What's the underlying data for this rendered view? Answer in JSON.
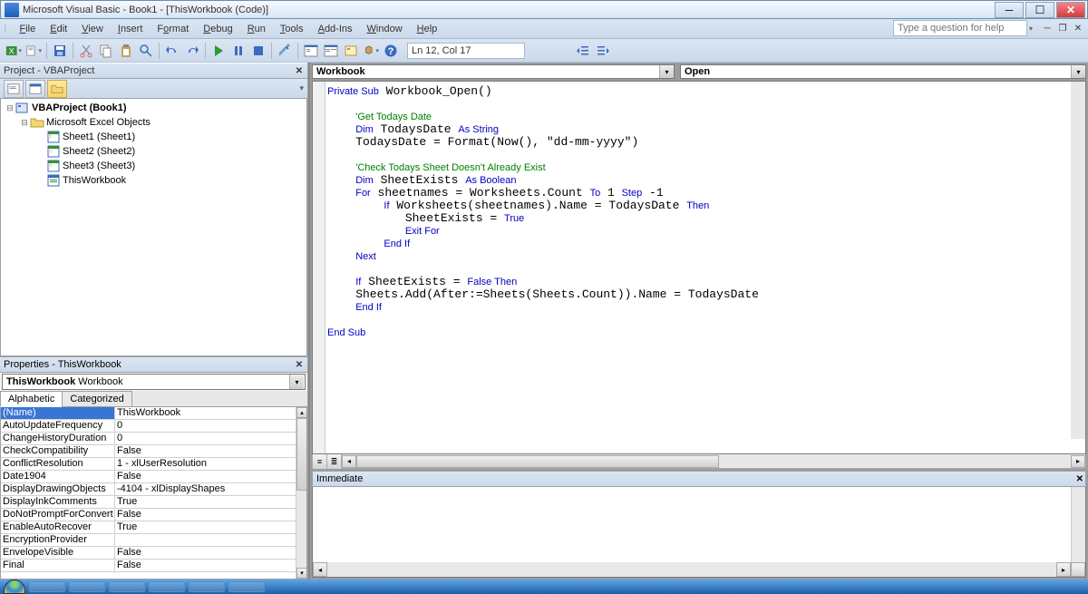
{
  "titlebar": {
    "text": "Microsoft Visual Basic - Book1 - [ThisWorkbook (Code)]"
  },
  "menubar": {
    "items": [
      {
        "pre": "F",
        "mid": "",
        "post": "ile"
      },
      {
        "pre": "E",
        "mid": "",
        "post": "dit"
      },
      {
        "pre": "V",
        "mid": "",
        "post": "iew"
      },
      {
        "pre": "I",
        "mid": "",
        "post": "nsert"
      },
      {
        "pre": "F",
        "mid": "o",
        "post": "rmat"
      },
      {
        "pre": "D",
        "mid": "",
        "post": "ebug"
      },
      {
        "pre": "R",
        "mid": "",
        "post": "un"
      },
      {
        "pre": "T",
        "mid": "",
        "post": "ools"
      },
      {
        "pre": "A",
        "mid": "",
        "post": "dd-Ins"
      },
      {
        "pre": "W",
        "mid": "",
        "post": "indow"
      },
      {
        "pre": "H",
        "mid": "",
        "post": "elp"
      }
    ],
    "help_placeholder": "Type a question for help"
  },
  "toolbar": {
    "position": "Ln 12, Col 17"
  },
  "project_panel": {
    "title": "Project - VBAProject",
    "tree": [
      {
        "indent": 0,
        "expander": "⊟",
        "icon": "proj",
        "text": "VBAProject (Book1)",
        "bold": true
      },
      {
        "indent": 1,
        "expander": "⊟",
        "icon": "folder",
        "text": "Microsoft Excel Objects"
      },
      {
        "indent": 2,
        "expander": "",
        "icon": "sheet",
        "text": "Sheet1 (Sheet1)"
      },
      {
        "indent": 2,
        "expander": "",
        "icon": "sheet",
        "text": "Sheet2 (Sheet2)"
      },
      {
        "indent": 2,
        "expander": "",
        "icon": "sheet",
        "text": "Sheet3 (Sheet3)"
      },
      {
        "indent": 2,
        "expander": "",
        "icon": "wb",
        "text": "ThisWorkbook"
      }
    ]
  },
  "properties_panel": {
    "title": "Properties - ThisWorkbook",
    "object_name": "ThisWorkbook",
    "object_type": "Workbook",
    "tabs": {
      "alphabetic": "Alphabetic",
      "categorized": "Categorized"
    },
    "rows": [
      {
        "name": "(Name)",
        "value": "ThisWorkbook",
        "selected": true
      },
      {
        "name": "AutoUpdateFrequency",
        "value": "0"
      },
      {
        "name": "ChangeHistoryDuration",
        "value": "0"
      },
      {
        "name": "CheckCompatibility",
        "value": "False"
      },
      {
        "name": "ConflictResolution",
        "value": "1 - xlUserResolution"
      },
      {
        "name": "Date1904",
        "value": "False"
      },
      {
        "name": "DisplayDrawingObjects",
        "value": "-4104 - xlDisplayShapes"
      },
      {
        "name": "DisplayInkComments",
        "value": "True"
      },
      {
        "name": "DoNotPromptForConvert",
        "value": "False"
      },
      {
        "name": "EnableAutoRecover",
        "value": "True"
      },
      {
        "name": "EncryptionProvider",
        "value": ""
      },
      {
        "name": "EnvelopeVisible",
        "value": "False"
      },
      {
        "name": "Final",
        "value": "False"
      }
    ]
  },
  "code_panel": {
    "object_combo": "Workbook",
    "proc_combo": "Open"
  },
  "immediate": {
    "title": "Immediate"
  }
}
